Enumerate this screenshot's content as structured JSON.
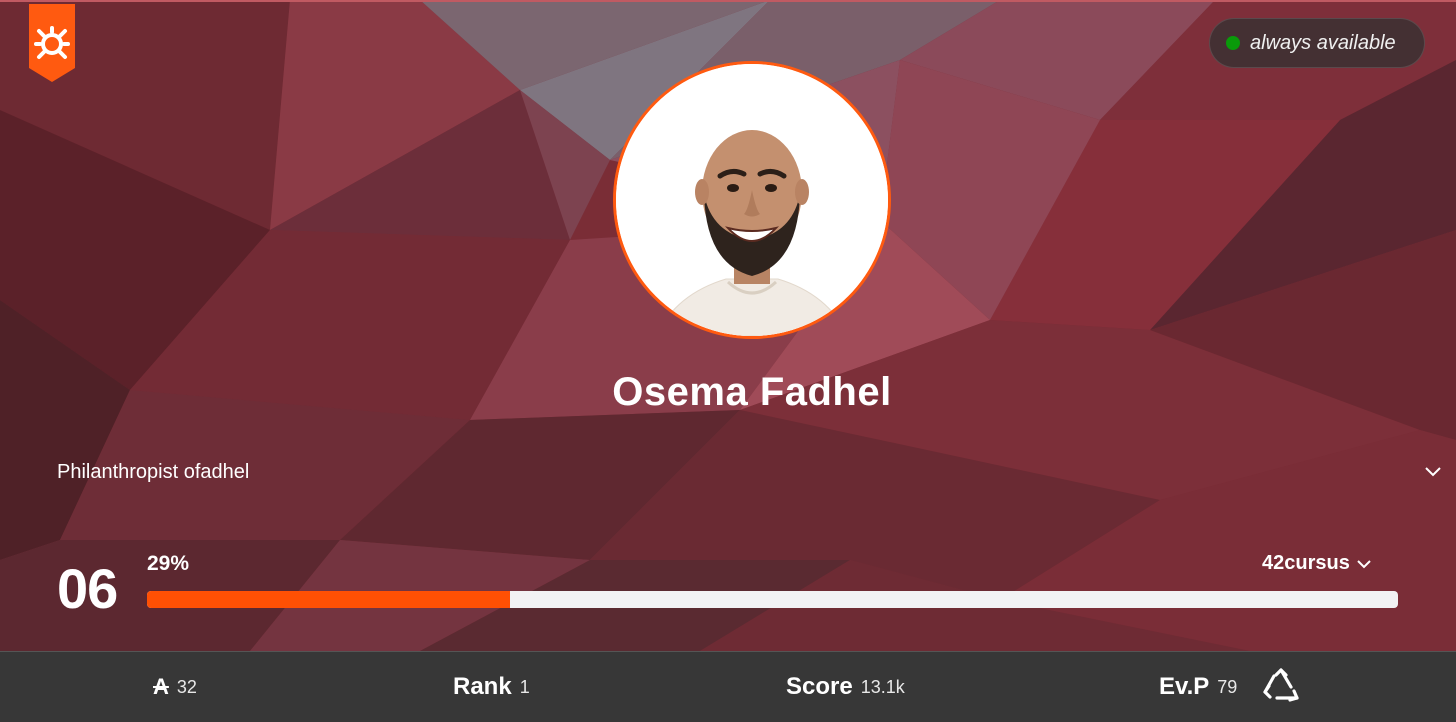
{
  "availability": {
    "status_text": "always available",
    "status_color": "#0a9a0a"
  },
  "profile": {
    "name": "Osema Fadhel",
    "title": "Philanthropist ofadhel",
    "avatar_icon": "user-photo"
  },
  "level": {
    "number": "06",
    "percent_label": "29%",
    "progress_fraction": 0.29,
    "cursus_label": "42cursus"
  },
  "stats": {
    "wallet": {
      "symbol": "A",
      "value": "32"
    },
    "rank": {
      "label": "Rank",
      "value": "1"
    },
    "score": {
      "label": "Score",
      "value": "13.1k"
    },
    "evp": {
      "label": "Ev.P",
      "value": "79"
    }
  },
  "colors": {
    "accent": "#ff5004",
    "hero_base": "#7a2d36",
    "stats_bg": "#373737"
  },
  "icons": {
    "coalition": "coalition-badge-icon",
    "title_toggle": "chevron-down-icon",
    "cursus_toggle": "chevron-down-icon",
    "evaluation": "recycle-icon"
  }
}
